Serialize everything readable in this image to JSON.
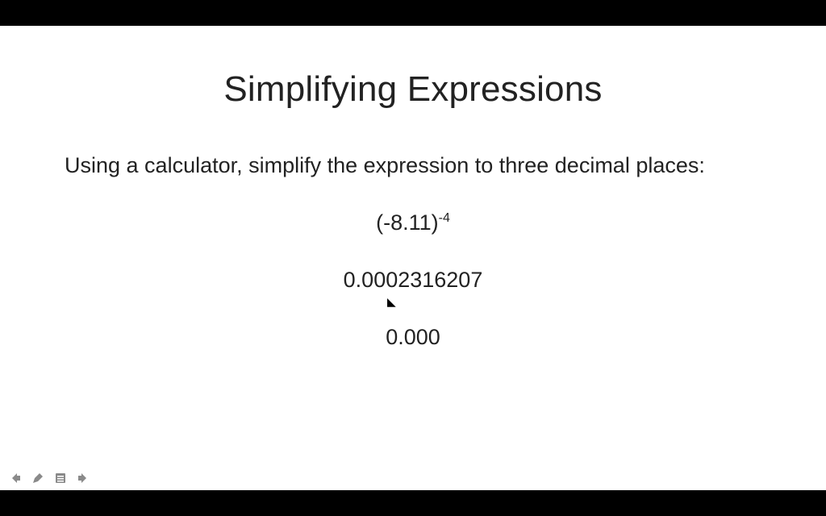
{
  "slide": {
    "title": "Simplifying Expressions",
    "instruction": "Using a calculator, simplify the expression to three decimal places:",
    "expression_base": "(-8.11)",
    "expression_exponent": "-4",
    "result_full": "0.0002316207",
    "result_rounded": "0.000"
  },
  "toolbar": {
    "prev_label": "previous-slide",
    "pen_label": "pen-tool",
    "menu_label": "slide-menu",
    "next_label": "next-slide"
  }
}
